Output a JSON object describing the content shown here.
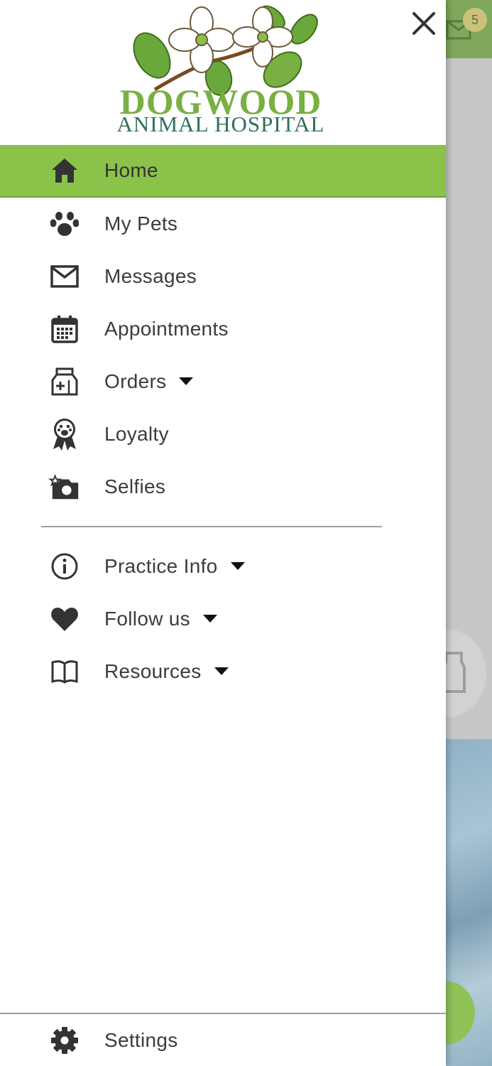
{
  "background": {
    "badge_count": "5"
  },
  "logo": {
    "title": "DOGWOOD",
    "subtitle": "ANIMAL HOSPITAL"
  },
  "menu": {
    "items": [
      {
        "label": "Home",
        "icon": "home-icon"
      },
      {
        "label": "My Pets",
        "icon": "paw-icon"
      },
      {
        "label": "Messages",
        "icon": "mail-icon"
      },
      {
        "label": "Appointments",
        "icon": "calendar-icon"
      },
      {
        "label": "Orders",
        "icon": "medication-jar-icon"
      },
      {
        "label": "Loyalty",
        "icon": "ribbon-award-icon"
      },
      {
        "label": "Selfies",
        "icon": "camera-star-icon"
      }
    ],
    "secondary": [
      {
        "label": "Practice Info",
        "icon": "info-icon"
      },
      {
        "label": "Follow us",
        "icon": "heart-icon"
      },
      {
        "label": "Resources",
        "icon": "book-icon"
      }
    ],
    "settings_label": "Settings"
  },
  "colors": {
    "accent": "#8bc34a",
    "text": "#3c3c3c",
    "icon": "#333333"
  }
}
